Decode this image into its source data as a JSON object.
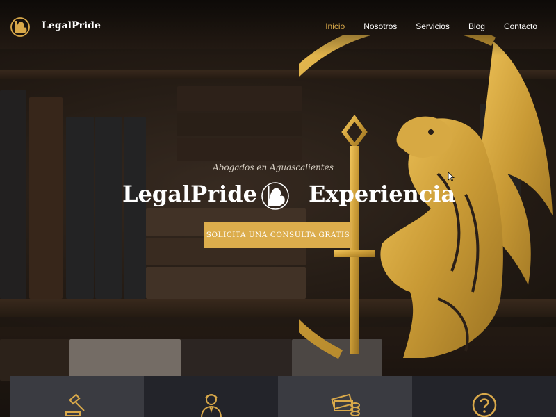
{
  "header": {
    "brand": "LegalPride",
    "nav": [
      {
        "label": "Inicio",
        "active": true
      },
      {
        "label": "Nosotros",
        "active": false
      },
      {
        "label": "Servicios",
        "active": false
      },
      {
        "label": "Blog",
        "active": false
      },
      {
        "label": "Contacto",
        "active": false
      }
    ]
  },
  "hero": {
    "subtitle": "Abogados en Aguascalientes",
    "headline_left": "LegalPride",
    "headline_right": "Experiencia",
    "cta_label": "SOLICITA UNA CONSULTA GRATIS"
  },
  "cards": [
    {
      "icon": "gavel-icon"
    },
    {
      "icon": "lawyer-icon"
    },
    {
      "icon": "money-icon"
    },
    {
      "icon": "question-icon"
    }
  ],
  "colors": {
    "accent": "#dcad4c",
    "nav_active": "#d9a94a",
    "text": "#ffffff"
  }
}
